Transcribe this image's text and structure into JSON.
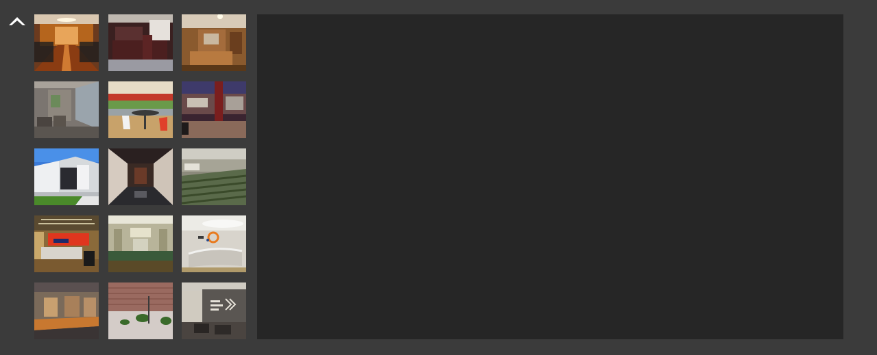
{
  "navigation": {
    "up_icon": "chevron-up-icon"
  },
  "gallery": {
    "thumbnails": [
      {
        "subject": "conference-room"
      },
      {
        "subject": "reception-desk-wood"
      },
      {
        "subject": "lobby-reception"
      },
      {
        "subject": "corridor-seating"
      },
      {
        "subject": "cafe-lounge"
      },
      {
        "subject": "lobby-purple"
      },
      {
        "subject": "building-exterior"
      },
      {
        "subject": "elevator-hall"
      },
      {
        "subject": "auditorium"
      },
      {
        "subject": "reception-red-wall"
      },
      {
        "subject": "stage-room"
      },
      {
        "subject": "white-reception"
      },
      {
        "subject": "storefront-wood"
      },
      {
        "subject": "plaza-exterior"
      },
      {
        "subject": "lobby-logo-wall"
      }
    ]
  },
  "viewer": {
    "background": "#262626"
  },
  "colors": {
    "page_background": "#3b3b3b",
    "viewer_background": "#262626",
    "icon": "#ffffff"
  }
}
